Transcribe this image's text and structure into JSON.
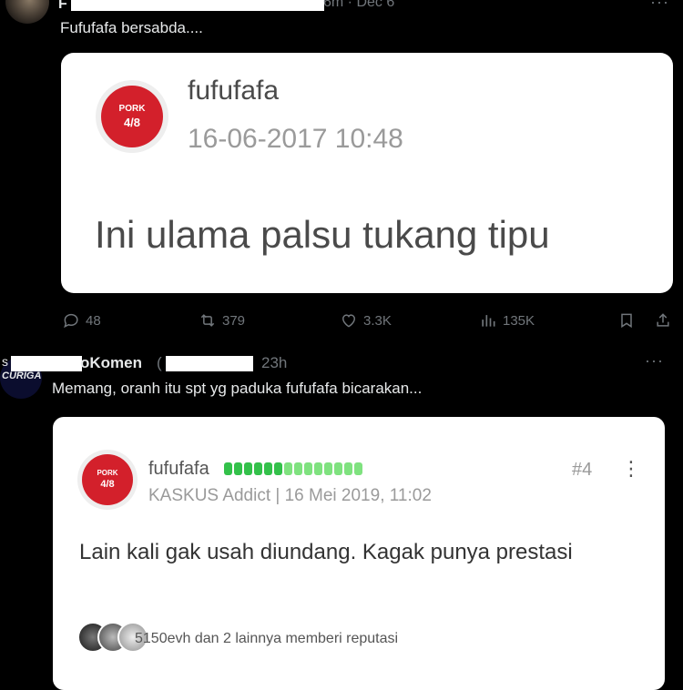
{
  "tweet1": {
    "name_initial": "F",
    "meta": "6m · Dec 6",
    "more": "···",
    "text": "Fufufafa bersabda....",
    "card": {
      "logo_text": "PORK",
      "logo_sub": "4/8",
      "username": "fufufafa",
      "datetime": "16-06-2017 10:48",
      "body": "Ini ulama palsu tukang tipu"
    },
    "actions": {
      "replies": "48",
      "reposts": "379",
      "likes": "3.3K",
      "views": "135K"
    }
  },
  "tweet2": {
    "name_initial": "s",
    "name": "oKomen",
    "paren": "(",
    "time": "23h",
    "more": "···",
    "avatar_text": "CURIGA",
    "text": "Memang, oranh itu spt yg paduka fufufafa bicarakan...",
    "card": {
      "logo_text": "PORK",
      "logo_sub": "4/8",
      "username": "fufufafa",
      "post_number": "#4",
      "kebab": "⋮",
      "meta": "KASKUS Addict | 16 Mei 2019, 11:02",
      "body": "Lain kali gak usah diundang. Kagak punya prestasi",
      "reputation": "5150evh dan 2 lainnya memberi reputasi"
    }
  },
  "colors": {
    "background": "#000000",
    "muted": "#71767b",
    "logo_red": "#d3202b",
    "rank_green": "#33c14a"
  }
}
